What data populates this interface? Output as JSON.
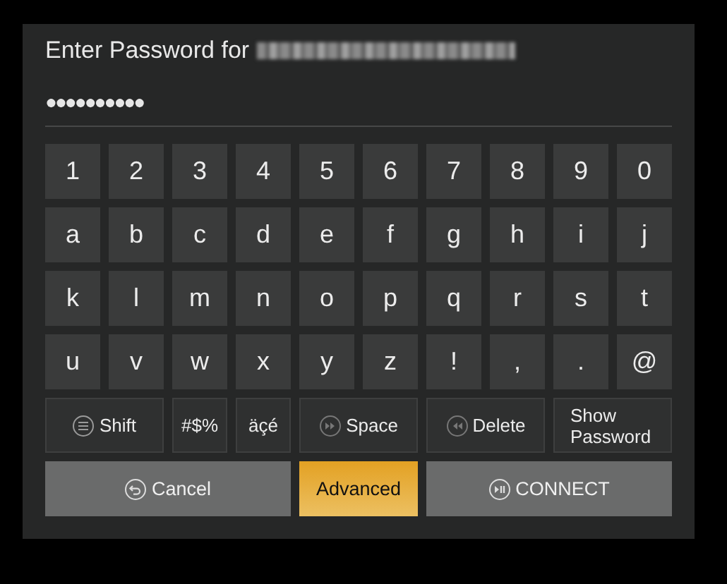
{
  "dialog": {
    "title": "Enter Password for",
    "network_name_blurred": true,
    "password": "●●●●●●●●●●"
  },
  "keyboard": {
    "rows": [
      [
        "1",
        "2",
        "3",
        "4",
        "5",
        "6",
        "7",
        "8",
        "9",
        "0"
      ],
      [
        "a",
        "b",
        "c",
        "d",
        "e",
        "f",
        "g",
        "h",
        "i",
        "j"
      ],
      [
        "k",
        "l",
        "m",
        "n",
        "o",
        "p",
        "q",
        "r",
        "s",
        "t"
      ],
      [
        "u",
        "v",
        "w",
        "x",
        "y",
        "z",
        "!",
        ",",
        ".",
        "@"
      ]
    ],
    "special_keys": [
      {
        "label": "Shift",
        "kind": "shift"
      },
      {
        "label": "#$%",
        "kind": "plain"
      },
      {
        "label": "äçé",
        "kind": "plain"
      },
      {
        "label": "Space",
        "kind": "space"
      },
      {
        "label": "Delete",
        "kind": "delete"
      },
      {
        "label": "Show Password",
        "kind": "toggle"
      }
    ]
  },
  "actions": [
    {
      "label": "Cancel",
      "kind": "cancel",
      "selected": false
    },
    {
      "label": "Advanced",
      "kind": "plain",
      "selected": true
    },
    {
      "label": "CONNECT",
      "kind": "connect",
      "selected": false
    }
  ]
}
